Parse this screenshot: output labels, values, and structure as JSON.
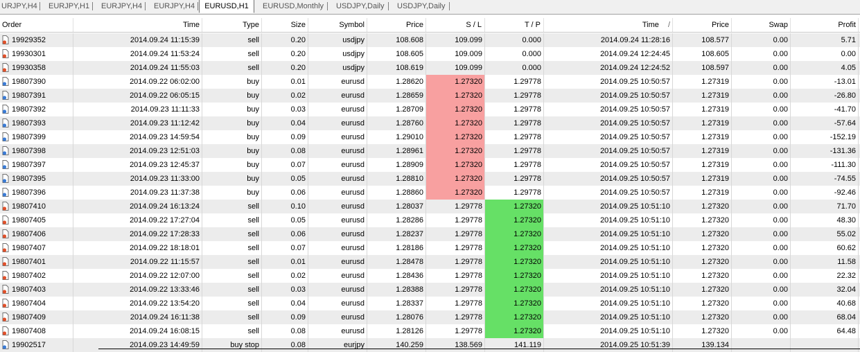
{
  "tabs": [
    {
      "label": "URJPY,H4",
      "active": false
    },
    {
      "label": "EURJPY,H1",
      "active": false
    },
    {
      "label": "EURJPY,H4",
      "active": false
    },
    {
      "label": "EURJPY,H4",
      "active": false
    },
    {
      "label": "EURUSD,H1",
      "active": true
    },
    {
      "label": "EURUSD,Monthly",
      "active": false
    },
    {
      "label": "USDJPY,Daily",
      "active": false
    },
    {
      "label": "USDJPY,Daily",
      "active": false
    }
  ],
  "columns": {
    "order": "Order",
    "time": "Time",
    "type": "Type",
    "size": "Size",
    "symbol": "Symbol",
    "price": "Price",
    "sl": "S / L",
    "tp": "T / P",
    "close_time": "Time",
    "sort_indicator": "/",
    "close_price": "Price",
    "swap": "Swap",
    "profit": "Profit"
  },
  "colors": {
    "sl_hit": "#f8a0a0",
    "tp_hit": "#66e066",
    "buy_icon": "#3a7bd5",
    "sell_icon": "#e0502a"
  },
  "rows": [
    {
      "order": "19929352",
      "time": "2014.09.24 11:15:39",
      "type": "sell",
      "size": "0.20",
      "symbol": "usdjpy",
      "price": "108.608",
      "sl": "109.099",
      "tp": "0.000",
      "close_time": "2014.09.24 11:28:16",
      "close_price": "108.577",
      "swap": "0.00",
      "profit": "5.71",
      "hit": ""
    },
    {
      "order": "19930301",
      "time": "2014.09.24 11:53:24",
      "type": "sell",
      "size": "0.20",
      "symbol": "usdjpy",
      "price": "108.605",
      "sl": "109.009",
      "tp": "0.000",
      "close_time": "2014.09.24 12:24:45",
      "close_price": "108.605",
      "swap": "0.00",
      "profit": "0.00",
      "hit": ""
    },
    {
      "order": "19930358",
      "time": "2014.09.24 11:55:03",
      "type": "sell",
      "size": "0.20",
      "symbol": "usdjpy",
      "price": "108.619",
      "sl": "109.099",
      "tp": "0.000",
      "close_time": "2014.09.24 12:24:52",
      "close_price": "108.597",
      "swap": "0.00",
      "profit": "4.05",
      "hit": ""
    },
    {
      "order": "19807390",
      "time": "2014.09.22 06:02:00",
      "type": "buy",
      "size": "0.01",
      "symbol": "eurusd",
      "price": "1.28620",
      "sl": "1.27320",
      "tp": "1.29778",
      "close_time": "2014.09.25 10:50:57",
      "close_price": "1.27319",
      "swap": "0.00",
      "profit": "-13.01",
      "hit": "sl"
    },
    {
      "order": "19807391",
      "time": "2014.09.22 06:05:15",
      "type": "buy",
      "size": "0.02",
      "symbol": "eurusd",
      "price": "1.28659",
      "sl": "1.27320",
      "tp": "1.29778",
      "close_time": "2014.09.25 10:50:57",
      "close_price": "1.27319",
      "swap": "0.00",
      "profit": "-26.80",
      "hit": "sl"
    },
    {
      "order": "19807392",
      "time": "2014.09.23 11:11:33",
      "type": "buy",
      "size": "0.03",
      "symbol": "eurusd",
      "price": "1.28709",
      "sl": "1.27320",
      "tp": "1.29778",
      "close_time": "2014.09.25 10:50:57",
      "close_price": "1.27319",
      "swap": "0.00",
      "profit": "-41.70",
      "hit": "sl"
    },
    {
      "order": "19807393",
      "time": "2014.09.23 11:12:42",
      "type": "buy",
      "size": "0.04",
      "symbol": "eurusd",
      "price": "1.28760",
      "sl": "1.27320",
      "tp": "1.29778",
      "close_time": "2014.09.25 10:50:57",
      "close_price": "1.27319",
      "swap": "0.00",
      "profit": "-57.64",
      "hit": "sl"
    },
    {
      "order": "19807399",
      "time": "2014.09.23 14:59:54",
      "type": "buy",
      "size": "0.09",
      "symbol": "eurusd",
      "price": "1.29010",
      "sl": "1.27320",
      "tp": "1.29778",
      "close_time": "2014.09.25 10:50:57",
      "close_price": "1.27319",
      "swap": "0.00",
      "profit": "-152.19",
      "hit": "sl"
    },
    {
      "order": "19807398",
      "time": "2014.09.23 12:51:03",
      "type": "buy",
      "size": "0.08",
      "symbol": "eurusd",
      "price": "1.28961",
      "sl": "1.27320",
      "tp": "1.29778",
      "close_time": "2014.09.25 10:50:57",
      "close_price": "1.27319",
      "swap": "0.00",
      "profit": "-131.36",
      "hit": "sl"
    },
    {
      "order": "19807397",
      "time": "2014.09.23 12:45:37",
      "type": "buy",
      "size": "0.07",
      "symbol": "eurusd",
      "price": "1.28909",
      "sl": "1.27320",
      "tp": "1.29778",
      "close_time": "2014.09.25 10:50:57",
      "close_price": "1.27319",
      "swap": "0.00",
      "profit": "-111.30",
      "hit": "sl"
    },
    {
      "order": "19807395",
      "time": "2014.09.23 11:33:00",
      "type": "buy",
      "size": "0.05",
      "symbol": "eurusd",
      "price": "1.28810",
      "sl": "1.27320",
      "tp": "1.29778",
      "close_time": "2014.09.25 10:50:57",
      "close_price": "1.27319",
      "swap": "0.00",
      "profit": "-74.55",
      "hit": "sl"
    },
    {
      "order": "19807396",
      "time": "2014.09.23 11:37:38",
      "type": "buy",
      "size": "0.06",
      "symbol": "eurusd",
      "price": "1.28860",
      "sl": "1.27320",
      "tp": "1.29778",
      "close_time": "2014.09.25 10:50:57",
      "close_price": "1.27319",
      "swap": "0.00",
      "profit": "-92.46",
      "hit": "sl"
    },
    {
      "order": "19807410",
      "time": "2014.09.24 16:13:24",
      "type": "sell",
      "size": "0.10",
      "symbol": "eurusd",
      "price": "1.28037",
      "sl": "1.29778",
      "tp": "1.27320",
      "close_time": "2014.09.25 10:51:10",
      "close_price": "1.27320",
      "swap": "0.00",
      "profit": "71.70",
      "hit": "tp"
    },
    {
      "order": "19807405",
      "time": "2014.09.22 17:27:04",
      "type": "sell",
      "size": "0.05",
      "symbol": "eurusd",
      "price": "1.28286",
      "sl": "1.29778",
      "tp": "1.27320",
      "close_time": "2014.09.25 10:51:10",
      "close_price": "1.27320",
      "swap": "0.00",
      "profit": "48.30",
      "hit": "tp"
    },
    {
      "order": "19807406",
      "time": "2014.09.22 17:28:33",
      "type": "sell",
      "size": "0.06",
      "symbol": "eurusd",
      "price": "1.28237",
      "sl": "1.29778",
      "tp": "1.27320",
      "close_time": "2014.09.25 10:51:10",
      "close_price": "1.27320",
      "swap": "0.00",
      "profit": "55.02",
      "hit": "tp"
    },
    {
      "order": "19807407",
      "time": "2014.09.22 18:18:01",
      "type": "sell",
      "size": "0.07",
      "symbol": "eurusd",
      "price": "1.28186",
      "sl": "1.29778",
      "tp": "1.27320",
      "close_time": "2014.09.25 10:51:10",
      "close_price": "1.27320",
      "swap": "0.00",
      "profit": "60.62",
      "hit": "tp"
    },
    {
      "order": "19807401",
      "time": "2014.09.22 11:15:57",
      "type": "sell",
      "size": "0.01",
      "symbol": "eurusd",
      "price": "1.28478",
      "sl": "1.29778",
      "tp": "1.27320",
      "close_time": "2014.09.25 10:51:10",
      "close_price": "1.27320",
      "swap": "0.00",
      "profit": "11.58",
      "hit": "tp"
    },
    {
      "order": "19807402",
      "time": "2014.09.22 12:07:00",
      "type": "sell",
      "size": "0.02",
      "symbol": "eurusd",
      "price": "1.28436",
      "sl": "1.29778",
      "tp": "1.27320",
      "close_time": "2014.09.25 10:51:10",
      "close_price": "1.27320",
      "swap": "0.00",
      "profit": "22.32",
      "hit": "tp"
    },
    {
      "order": "19807403",
      "time": "2014.09.22 13:33:46",
      "type": "sell",
      "size": "0.03",
      "symbol": "eurusd",
      "price": "1.28388",
      "sl": "1.29778",
      "tp": "1.27320",
      "close_time": "2014.09.25 10:51:10",
      "close_price": "1.27320",
      "swap": "0.00",
      "profit": "32.04",
      "hit": "tp"
    },
    {
      "order": "19807404",
      "time": "2014.09.22 13:54:20",
      "type": "sell",
      "size": "0.04",
      "symbol": "eurusd",
      "price": "1.28337",
      "sl": "1.29778",
      "tp": "1.27320",
      "close_time": "2014.09.25 10:51:10",
      "close_price": "1.27320",
      "swap": "0.00",
      "profit": "40.68",
      "hit": "tp"
    },
    {
      "order": "19807409",
      "time": "2014.09.24 16:11:38",
      "type": "sell",
      "size": "0.09",
      "symbol": "eurusd",
      "price": "1.28076",
      "sl": "1.29778",
      "tp": "1.27320",
      "close_time": "2014.09.25 10:51:10",
      "close_price": "1.27320",
      "swap": "0.00",
      "profit": "68.04",
      "hit": "tp"
    },
    {
      "order": "19807408",
      "time": "2014.09.24 16:08:15",
      "type": "sell",
      "size": "0.08",
      "symbol": "eurusd",
      "price": "1.28126",
      "sl": "1.29778",
      "tp": "1.27320",
      "close_time": "2014.09.25 10:51:10",
      "close_price": "1.27320",
      "swap": "0.00",
      "profit": "64.48",
      "hit": "tp"
    },
    {
      "order": "19902517",
      "time": "2014.09.23 14:49:59",
      "type": "buy stop",
      "size": "0.08",
      "symbol": "eurjpy",
      "price": "140.259",
      "sl": "138.569",
      "tp": "141.119",
      "close_time": "2014.09.25 10:51:39",
      "close_price": "139.134",
      "swap": "",
      "profit": "",
      "hit": ""
    }
  ]
}
